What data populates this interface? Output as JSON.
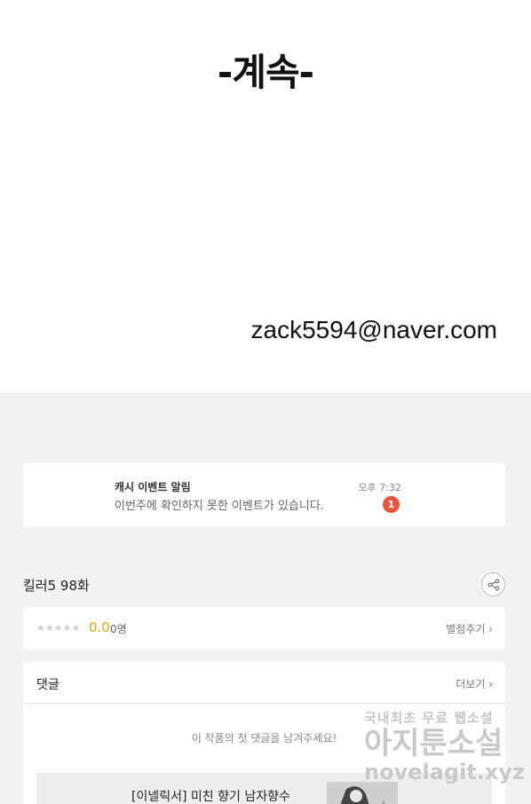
{
  "comic": {
    "end_text": "-계속-",
    "email": "zack5594@naver.com"
  },
  "notice": {
    "title": "캐시 이벤트 알림",
    "body": "이번주에 확인하지 못한 이벤트가 있습니다.",
    "time": "오후 7:32",
    "badge": "1"
  },
  "episode": {
    "title": "킬러5 98화",
    "share_icon": "share-icon"
  },
  "rating": {
    "stars": "★★★★★",
    "score": "0.0",
    "count": "0명",
    "rate_link": "별점주기 ›",
    "star_color": "#cfcfcf",
    "score_color": "#f0a500"
  },
  "comments": {
    "title": "댓글",
    "more_link": "더보기 ›",
    "empty_message": "이 작품의 첫 댓글을 남겨주세요!"
  },
  "ad": {
    "text": "[이넬릭서] 미친 향기 남자향수"
  },
  "watermark": {
    "line1": "국내최초 무료 웹소설",
    "line2": "아지툰소설",
    "line3": "novelagit.xyz"
  }
}
